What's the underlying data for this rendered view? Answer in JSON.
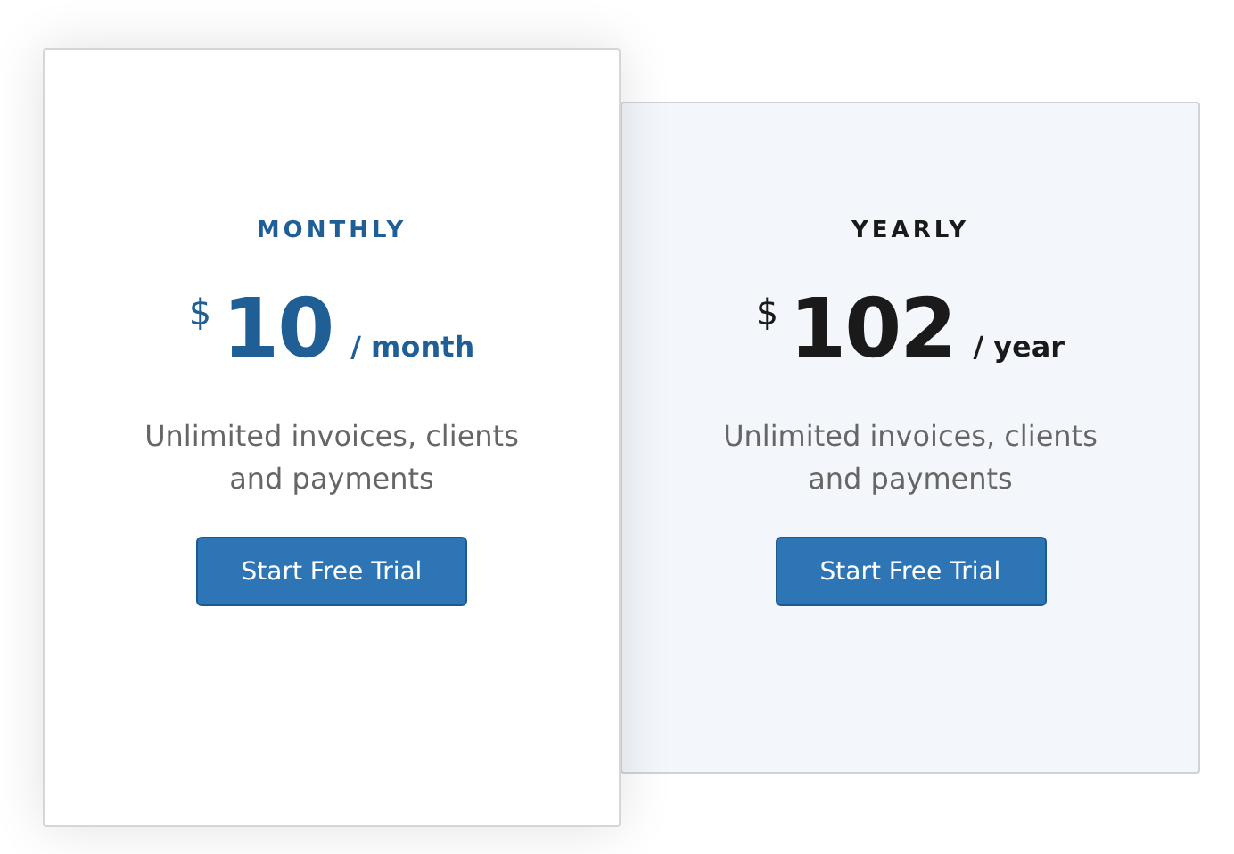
{
  "plans": [
    {
      "name": "MONTHLY",
      "currency": "$",
      "price": "10",
      "period": "/ month",
      "description": "Unlimited invoices, clients and payments",
      "button": "Start Free Trial",
      "selected": true
    },
    {
      "name": "YEARLY",
      "currency": "$",
      "price": "102",
      "period": "/ year",
      "description": "Unlimited invoices, clients and payments",
      "button": "Start Free Trial",
      "selected": false
    }
  ]
}
